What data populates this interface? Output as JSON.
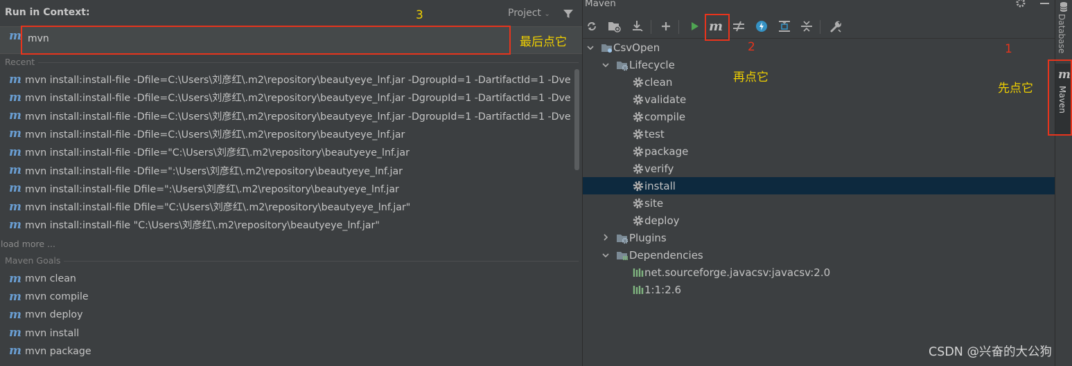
{
  "run_context": {
    "title": "Run in Context:",
    "scope_dropdown": "Project",
    "input_value": "mvn",
    "recent_label": "Recent",
    "recent_items": [
      "mvn install:install-file -Dfile=C:\\Users\\刘彦红\\.m2\\repository\\beautyeye_lnf.jar -DgroupId=1 -DartifactId=1 -Dve",
      "mvn install:install-file -Dfile=C:\\Users\\刘彦红\\.m2\\repository\\beautyeye_lnf.jar -DgroupId=1 -DartifactId=1 -Dve",
      "mvn install:install-file -Dfile=C:\\Users\\刘彦红\\.m2\\repository\\beautyeye_lnf.jar -DgroupId=1 -DartifactId=1 -Dve",
      "mvn install:install-file -Dfile=C:\\Users\\刘彦红\\.m2\\repository\\beautyeye_lnf.jar",
      "mvn install:install-file -Dfile=\"C:\\Users\\刘彦红\\.m2\\repository\\beautyeye_lnf.jar",
      "mvn install:install-file -Dfile=\":\\Users\\刘彦红\\.m2\\repository\\beautyeye_lnf.jar",
      "mvn install:install-file Dfile=\":\\Users\\刘彦红\\.m2\\repository\\beautyeye_lnf.jar",
      "mvn install:install-file Dfile=\"C:\\Users\\刘彦红\\.m2\\repository\\beautyeye_lnf.jar\"",
      "mvn install:install-file \"C:\\Users\\刘彦红\\.m2\\repository\\beautyeye_lnf.jar\""
    ],
    "load_more": "load more ...",
    "goals_label": "Maven Goals",
    "goal_items": [
      "mvn clean",
      "mvn compile",
      "mvn deploy",
      "mvn install",
      "mvn package"
    ]
  },
  "maven": {
    "title": "Maven",
    "toolbar_icons": [
      "reload-icon",
      "import-folder-icon",
      "download-icon",
      "add-icon",
      "run-icon",
      "maven-goal-icon",
      "toggle-offline-icon",
      "skip-tests-icon",
      "show-dependencies-icon",
      "collapse-all-icon",
      "settings-wrench-icon"
    ],
    "tree": {
      "project": "CsvOpen",
      "lifecycle": "Lifecycle",
      "phases": [
        "clean",
        "validate",
        "compile",
        "test",
        "package",
        "verify",
        "install",
        "site",
        "deploy"
      ],
      "selected_phase": "install",
      "plugins": "Plugins",
      "dependencies": "Dependencies",
      "dependency_items": [
        "net.sourceforge.javacsv:javacsv:2.0",
        "1:1:2.6"
      ]
    }
  },
  "side_strip": {
    "database_label": "Database",
    "maven_label": "Maven"
  },
  "annotations": {
    "num1": "1",
    "num2": "2",
    "num3": "3",
    "first_click": "先点它",
    "then_click": "再点它",
    "last_click": "最后点它"
  },
  "watermark": "CSDN @兴奋的大公狗",
  "colors": {
    "annotation_red": "#e8341c",
    "annotation_yellow": "#f0d000",
    "maven_blue": "#6a9fd4",
    "selection": "#0d293e"
  }
}
